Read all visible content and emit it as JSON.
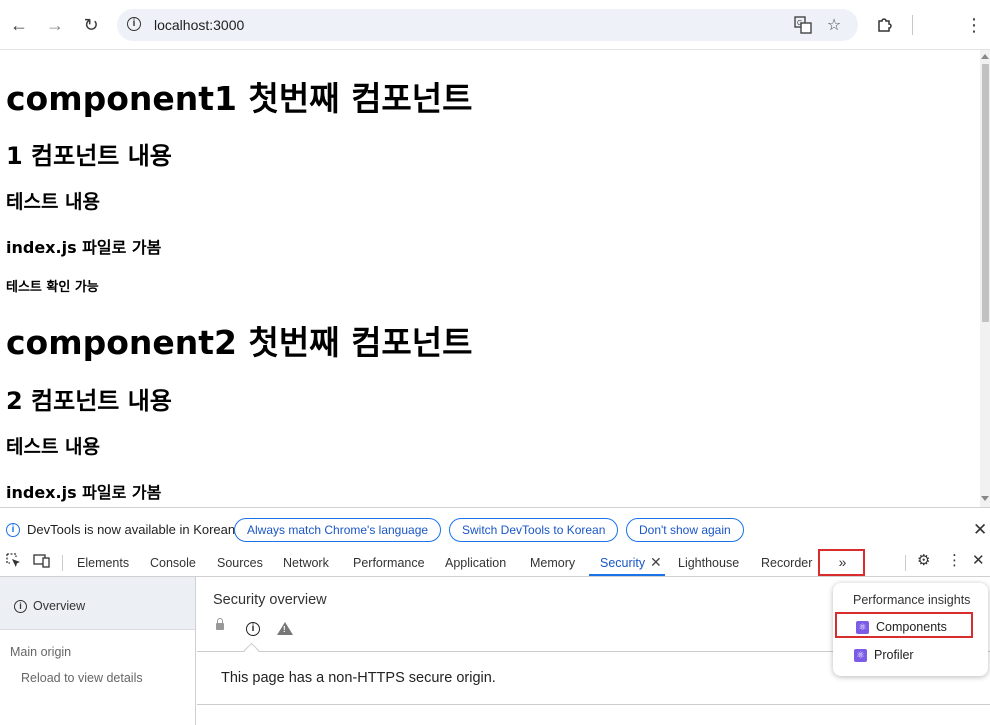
{
  "browser": {
    "url": "localhost:3000",
    "icons": {
      "back": "back-arrow-icon",
      "forward": "forward-arrow-icon",
      "reload": "reload-icon",
      "site_info": "info-icon",
      "translate": "translate-icon",
      "bookmark": "star-icon",
      "extensions": "puzzle-icon",
      "menu": "kebab-menu-icon"
    }
  },
  "page": {
    "lines": [
      "component1 첫번째 컴포넌트",
      "1 컴포넌트 내용",
      "테스트 내용",
      "index.js 파일로 가봄",
      "테스트 확인 가능",
      "component2 첫번째 컴포넌트",
      "2 컴포넌트 내용",
      "테스트 내용",
      "index.js 파일로 가봄"
    ]
  },
  "infobar": {
    "message": "DevTools is now available in Korean!",
    "buttons": [
      "Always match Chrome's language",
      "Switch DevTools to Korean",
      "Don't show again"
    ]
  },
  "devtools": {
    "tabs": [
      "Elements",
      "Console",
      "Sources",
      "Network",
      "Performance",
      "Application",
      "Memory",
      "Security",
      "Lighthouse",
      "Recorder"
    ],
    "active_tab": "Security",
    "more_tabs": "»",
    "sidebar": {
      "overview": "Overview",
      "main_origin": "Main origin",
      "reload_hint": "Reload to view details"
    },
    "main": {
      "title": "Security overview",
      "message": "This page has a non-HTTPS secure origin."
    },
    "overflow_menu": {
      "header": "Performance insights",
      "items": [
        "Components",
        "Profiler"
      ],
      "highlighted": "Components"
    }
  },
  "colors": {
    "accent": "#1a73e8",
    "highlight_box": "#d92c2c",
    "react_icon": "#7c5ce6"
  }
}
